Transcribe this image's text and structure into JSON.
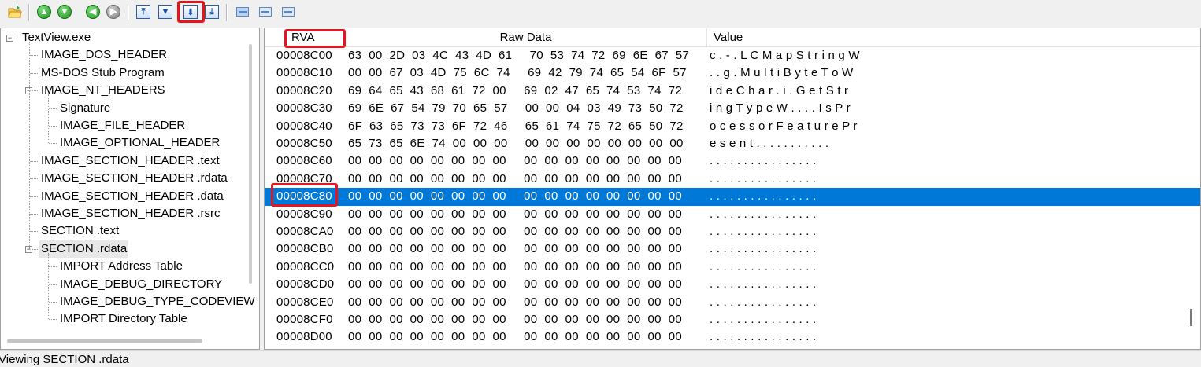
{
  "toolbar": {
    "icons": [
      "open-folder-icon",
      "go-up-icon",
      "go-down-icon",
      "go-back-icon",
      "go-forward-icon",
      "first-record-icon",
      "previous-record-icon",
      "next-record-icon",
      "last-record-icon",
      "view-hex-icon",
      "view-list-icon",
      "view-details-icon"
    ],
    "highlighted_button": "next-record-icon"
  },
  "tree": {
    "items": [
      {
        "label": "TextView.exe",
        "level": 0,
        "expander": "−"
      },
      {
        "label": "IMAGE_DOS_HEADER",
        "level": 1
      },
      {
        "label": "MS-DOS Stub Program",
        "level": 1
      },
      {
        "label": "IMAGE_NT_HEADERS",
        "level": 1,
        "expander": "−"
      },
      {
        "label": "Signature",
        "level": 2
      },
      {
        "label": "IMAGE_FILE_HEADER",
        "level": 2
      },
      {
        "label": "IMAGE_OPTIONAL_HEADER",
        "level": 2
      },
      {
        "label": "IMAGE_SECTION_HEADER .text",
        "level": 1
      },
      {
        "label": "IMAGE_SECTION_HEADER .rdata",
        "level": 1
      },
      {
        "label": "IMAGE_SECTION_HEADER .data",
        "level": 1
      },
      {
        "label": "IMAGE_SECTION_HEADER .rsrc",
        "level": 1
      },
      {
        "label": "SECTION .text",
        "level": 1
      },
      {
        "label": "SECTION .rdata",
        "level": 1,
        "expander": "−",
        "selected": true
      },
      {
        "label": "IMPORT Address Table",
        "level": 2
      },
      {
        "label": "IMAGE_DEBUG_DIRECTORY",
        "level": 2
      },
      {
        "label": "IMAGE_DEBUG_TYPE_CODEVIEW",
        "level": 2
      },
      {
        "label": "IMPORT Directory Table",
        "level": 2
      }
    ]
  },
  "hex": {
    "columns": {
      "rva": "RVA",
      "raw": "Raw Data",
      "value": "Value"
    },
    "rows": [
      {
        "rva": "00008C00",
        "raw": "63  00  2D  03  4C  43  4D  61     70  53  74  72  69  6E  67  57",
        "value": "c . - . L C M a p S t r i n g W"
      },
      {
        "rva": "00008C10",
        "raw": "00  00  67  03  4D  75  6C  74     69  42  79  74  65  54  6F  57",
        "value": ". . g . M u l t i B y t e T o W"
      },
      {
        "rva": "00008C20",
        "raw": "69  64  65  43  68  61  72  00     69  02  47  65  74  53  74  72",
        "value": "i d e C h a r . i . G e t S t r"
      },
      {
        "rva": "00008C30",
        "raw": "69  6E  67  54  79  70  65  57     00  00  04  03  49  73  50  72",
        "value": "i n g T y p e W . . . . I s P r"
      },
      {
        "rva": "00008C40",
        "raw": "6F  63  65  73  73  6F  72  46     65  61  74  75  72  65  50  72",
        "value": "o c e s s o r F e a t u r e P r"
      },
      {
        "rva": "00008C50",
        "raw": "65  73  65  6E  74  00  00  00     00  00  00  00  00  00  00  00",
        "value": "e s e n t . . . . . . . . . . ."
      },
      {
        "rva": "00008C60",
        "raw": "00  00  00  00  00  00  00  00     00  00  00  00  00  00  00  00",
        "value": ". . . . . . . . . . . . . . . ."
      },
      {
        "rva": "00008C70",
        "raw": "00  00  00  00  00  00  00  00     00  00  00  00  00  00  00  00",
        "value": ". . . . . . . . . . . . . . . ."
      },
      {
        "rva": "00008C80",
        "raw": "00  00  00  00  00  00  00  00     00  00  00  00  00  00  00  00",
        "value": ". . . . . . . . . . . . . . . .",
        "selected": true
      },
      {
        "rva": "00008C90",
        "raw": "00  00  00  00  00  00  00  00     00  00  00  00  00  00  00  00",
        "value": ". . . . . . . . . . . . . . . ."
      },
      {
        "rva": "00008CA0",
        "raw": "00  00  00  00  00  00  00  00     00  00  00  00  00  00  00  00",
        "value": ". . . . . . . . . . . . . . . ."
      },
      {
        "rva": "00008CB0",
        "raw": "00  00  00  00  00  00  00  00     00  00  00  00  00  00  00  00",
        "value": ". . . . . . . . . . . . . . . ."
      },
      {
        "rva": "00008CC0",
        "raw": "00  00  00  00  00  00  00  00     00  00  00  00  00  00  00  00",
        "value": ". . . . . . . . . . . . . . . ."
      },
      {
        "rva": "00008CD0",
        "raw": "00  00  00  00  00  00  00  00     00  00  00  00  00  00  00  00",
        "value": ". . . . . . . . . . . . . . . ."
      },
      {
        "rva": "00008CE0",
        "raw": "00  00  00  00  00  00  00  00     00  00  00  00  00  00  00  00",
        "value": ". . . . . . . . . . . . . . . ."
      },
      {
        "rva": "00008CF0",
        "raw": "00  00  00  00  00  00  00  00     00  00  00  00  00  00  00  00",
        "value": ". . . . . . . . . . . . . . . ."
      },
      {
        "rva": "00008D00",
        "raw": "00  00  00  00  00  00  00  00     00  00  00  00  00  00  00  00",
        "value": ". . . . . . . . . . . . . . . ."
      }
    ]
  },
  "status": {
    "text": "Viewing SECTION .rdata"
  },
  "colors": {
    "selection": "#0078d7",
    "highlight_box": "#e8141d",
    "window_bg": "#f0f0f0"
  }
}
